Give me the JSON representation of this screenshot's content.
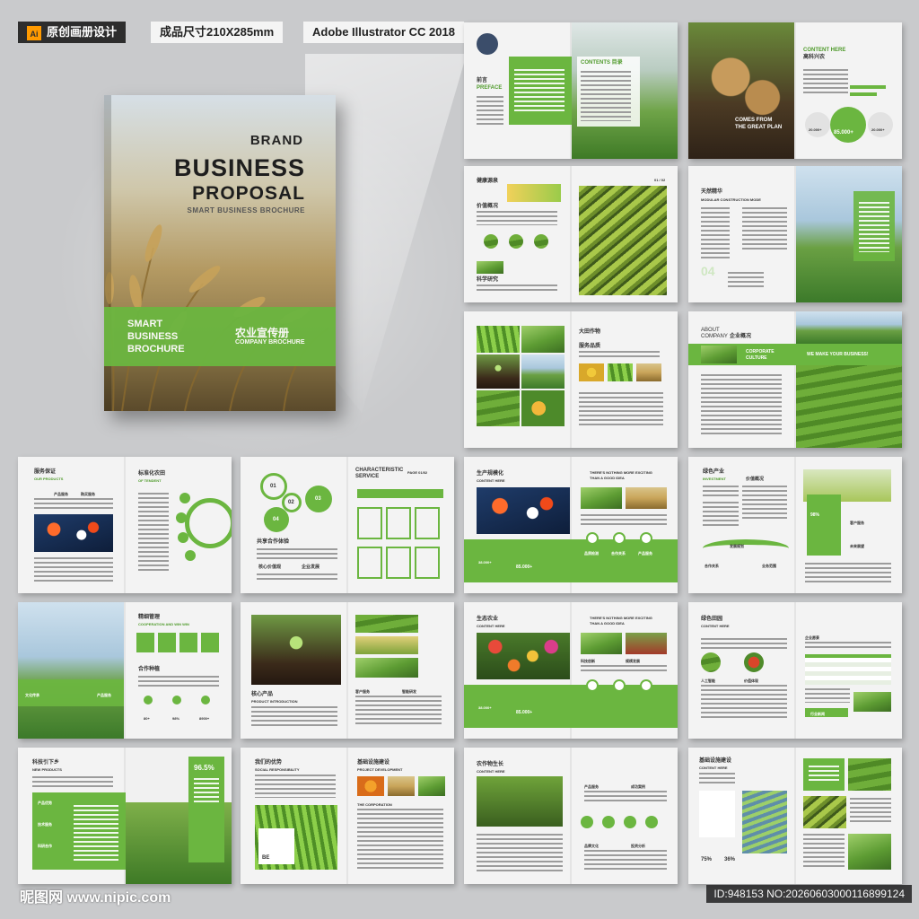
{
  "header": {
    "tag1": "原创画册设计",
    "tag1_icon": "Ai",
    "tag2": "成品尺寸210X285mm",
    "tag3": "Adobe Illustrator CC 2018"
  },
  "cover": {
    "brand": "BRAND",
    "title1": "BUSINESS",
    "title2": "PROPOSAL",
    "subtitle": "SMART BUSINESS BROCHURE",
    "band_left_1": "SMART",
    "band_left_2": "BUSINESS",
    "band_left_3": "BROCHURE",
    "band_right_cn": "农业宣传册",
    "band_right_en": "COMPANY BROCHURE"
  },
  "spreads": {
    "s1": {
      "a": "前言",
      "b": "PREFACE",
      "c": "CONTENTS 目录"
    },
    "s2": {
      "a": "CONTENT HERE",
      "b": "高科兴农",
      "c": "COMES FROM",
      "d": "THE GREAT PLAN",
      "e": "85.000+",
      "f": "20.000+",
      "g": "20.000+"
    },
    "s3": {
      "a": "健康源泉",
      "b": "价值概况",
      "c": "科学研究",
      "d": "01 / 02"
    },
    "s4": {
      "a": "天然精华",
      "b": "MODULAR CONSTRUCTION MODE",
      "c": "04"
    },
    "s5": {
      "a": "大田作物",
      "b": "服务品质"
    },
    "s6": {
      "a": "ABOUT",
      "b": "COMPANY",
      "c": "企业概况",
      "d": "CORPORATE",
      "e": "CULTURE",
      "f": "WE MAKE YOUR BUSINESS!"
    },
    "s7": {
      "a": "服务保证",
      "b": "OUR PRODUCTS",
      "c": "标准化农田",
      "d": "OF TENDENT",
      "e": "产品服务",
      "f": "购买服务"
    },
    "s8": {
      "a": "01",
      "b": "02",
      "c": "03",
      "d": "04",
      "e": "共享合作体验",
      "f": "核心价值观",
      "g": "企业发展",
      "h": "CHARACTERISTIC",
      "i": "SERVICE",
      "j": "PAGE 01/02"
    },
    "s9": {
      "a": "生产规模化",
      "b": "CONTENT HERE",
      "c": "THERE'S NOTHING MORE EXCITING",
      "d": "THAN A GOOD IDEA",
      "e": "38.000+",
      "f": "85.000+",
      "g": "品质检测",
      "h": "合作关系",
      "i": "产品服务"
    },
    "s10": {
      "a": "绿色产业",
      "b": "INVESTMENT",
      "c": "价值概况",
      "d": "98%",
      "e": "客户服务",
      "f": "未来展望",
      "g": "发展规划",
      "h": "合作关系",
      "i": "业务范围"
    },
    "s11": {
      "a": "精细管理",
      "b": "COOPERATION AND WIN WIN",
      "c": "合作种植",
      "d": "80+",
      "e": "98%",
      "f": "8900+",
      "g": "文化传承",
      "h": "产品服务"
    },
    "s12": {
      "a": "核心产品",
      "b": "PRODUCT INTRODUCTION",
      "c": "客户服务",
      "d": "智能研发"
    },
    "s13": {
      "a": "生态农业",
      "b": "CONTENT HERE",
      "c": "THERE'S NOTHING MORE EXCITING",
      "d": "THAN A GOOD IDEA",
      "e": "38.000+",
      "f": "85.000+",
      "g": "科技创新",
      "h": "规模发展"
    },
    "s14": {
      "a": "绿色田园",
      "b": "CONTENT HERE",
      "c": "企业愿景",
      "d": "人工智能",
      "e": "价值体现",
      "f": "行业新闻"
    },
    "s15": {
      "a": "科技引下乡",
      "b": "NEW PRODUCTS",
      "c": "96.5%",
      "d": "产品优势",
      "e": "技术服务",
      "f": "科研合作"
    },
    "s16": {
      "a": "我们的优势",
      "b": "SOCIAL RESPONSIBILITY",
      "c": "基础设施建设",
      "d": "PROJECT DEVELOPMENT",
      "e": "THE CORPORATION",
      "f": "BE"
    },
    "s17": {
      "a": "农作物生长",
      "b": "CONTENT HERE",
      "c": "产品服务",
      "d": "成功案例",
      "e": "品牌文化",
      "f": "投资分析"
    },
    "s18": {
      "a": "基础设施建设",
      "b": "CONTENT HERE",
      "c": "75%",
      "d": "36%"
    }
  },
  "watermark": "昵图网 www.nipic.com",
  "image_id": "ID:948153 NO:20260603000116899124",
  "colors": {
    "accent": "#6bb640",
    "dark": "#2d2d2d",
    "bg": "#c9cacc"
  }
}
